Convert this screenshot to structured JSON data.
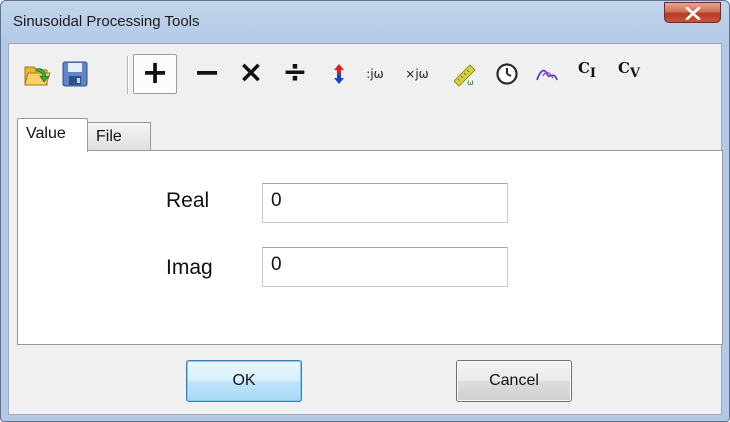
{
  "window": {
    "title": "Sinusoidal Processing Tools"
  },
  "toolbar": {
    "items": [
      {
        "name": "open-folder-icon"
      },
      {
        "name": "save-disk-icon"
      },
      {
        "name": "add",
        "glyph": "+"
      },
      {
        "name": "subtract",
        "glyph": "−"
      },
      {
        "name": "multiply",
        "glyph": "×"
      },
      {
        "name": "divide",
        "glyph": "÷"
      },
      {
        "name": "swap-arrows-icon"
      },
      {
        "name": "divide-jw",
        "glyph": ":jω"
      },
      {
        "name": "multiply-jw",
        "glyph": "×jω"
      },
      {
        "name": "ruler-omega-icon"
      },
      {
        "name": "clock-icon"
      },
      {
        "name": "arc-icon"
      },
      {
        "name": "ci",
        "glyph_main": "C",
        "glyph_sub": "I"
      },
      {
        "name": "cv",
        "glyph_main": "C",
        "glyph_sub": "V"
      }
    ]
  },
  "tabs": [
    {
      "label": "Value",
      "active": true
    },
    {
      "label": "File",
      "active": false
    }
  ],
  "form": {
    "real_label": "Real",
    "real_value": "0",
    "imag_label": "Imag",
    "imag_value": "0"
  },
  "buttons": {
    "ok": "OK",
    "cancel": "Cancel"
  },
  "colors": {
    "accent": "#3c7fb1",
    "close": "#c8553b",
    "arrow_red": "#d9201a",
    "arrow_blue": "#1c3fc8"
  }
}
